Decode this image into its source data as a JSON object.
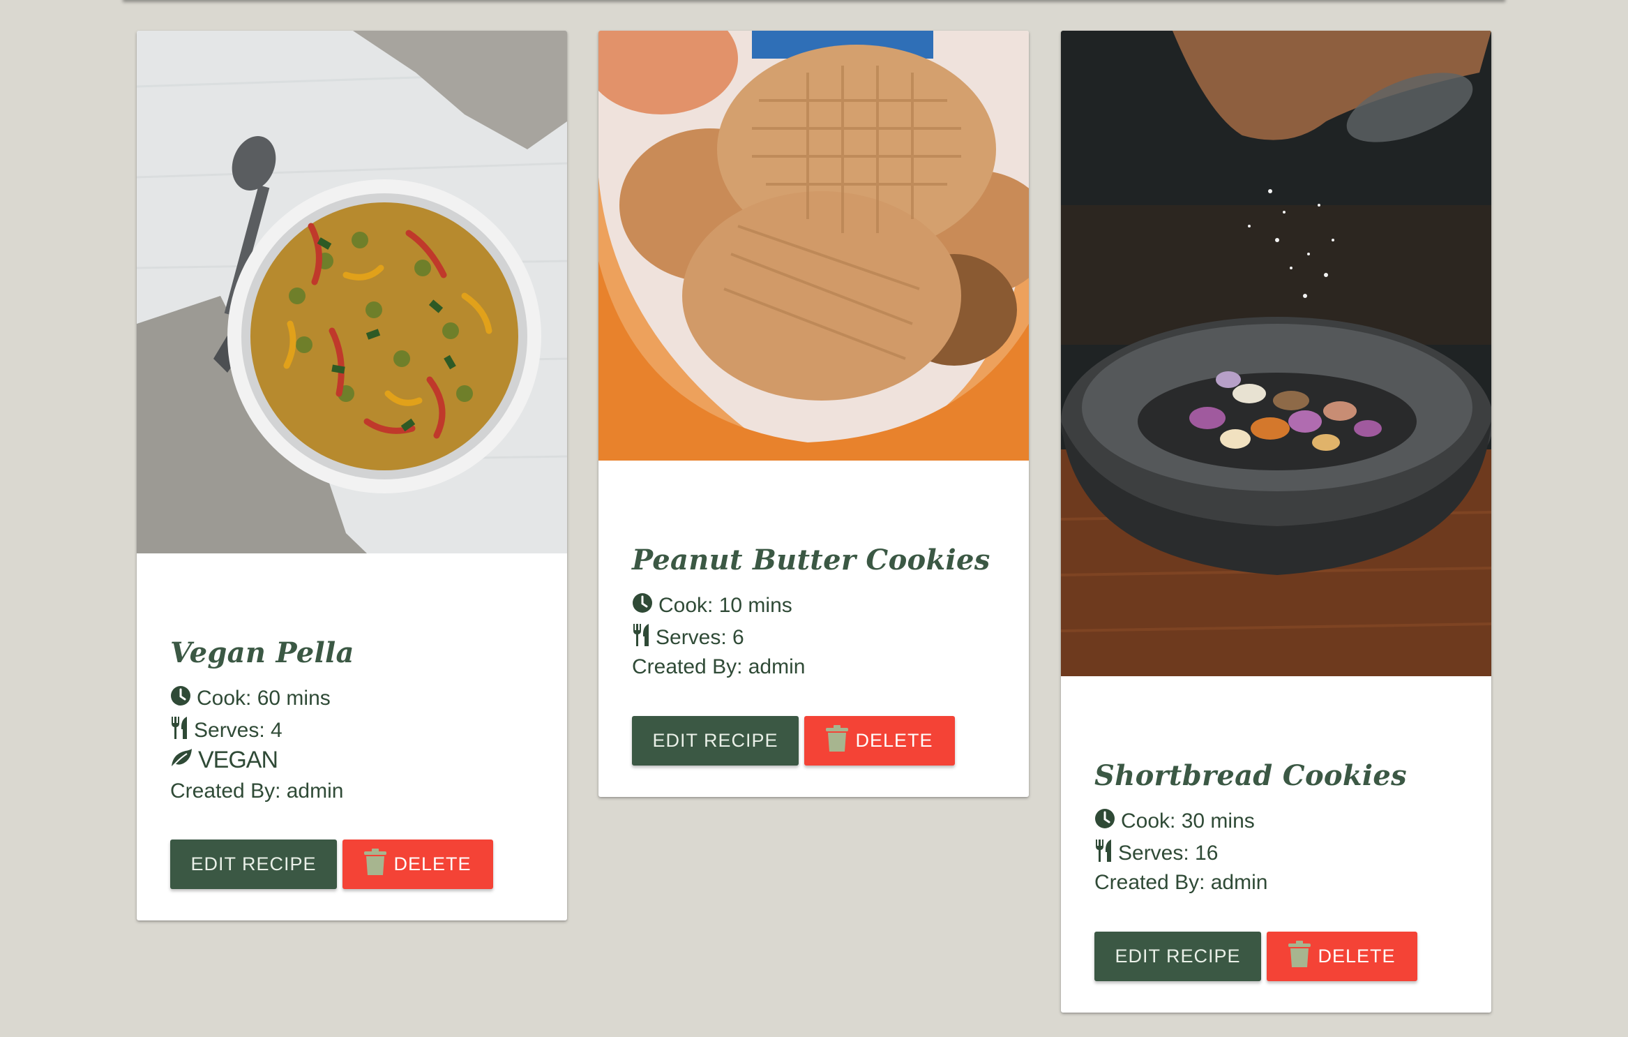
{
  "cards": [
    {
      "title": "Vegan Pella",
      "cook": "Cook: 60 mins",
      "serves": "Serves: 4",
      "vegan": "VEGAN",
      "created_by": "Created By: admin",
      "edit_label": "EDIT RECIPE",
      "delete_label": "DELETE",
      "image_icon": "paella-pan-photo"
    },
    {
      "title": "Peanut Butter Cookies",
      "cook": "Cook: 10 mins",
      "serves": "Serves: 6",
      "created_by": "Created By: admin",
      "edit_label": "EDIT RECIPE",
      "delete_label": "DELETE",
      "image_icon": "cookies-bowl-photo"
    },
    {
      "title": "Shortbread Cookies",
      "cook": "Cook: 30 mins",
      "serves": "Serves: 16",
      "created_by": "Created By: admin",
      "edit_label": "EDIT RECIPE",
      "delete_label": "DELETE",
      "image_icon": "mortar-bowl-photo"
    }
  ],
  "colors": {
    "background": "#dad8d0",
    "primary_green": "#3b5844",
    "delete_red": "#f44336",
    "trash_icon": "#a7b58f"
  }
}
